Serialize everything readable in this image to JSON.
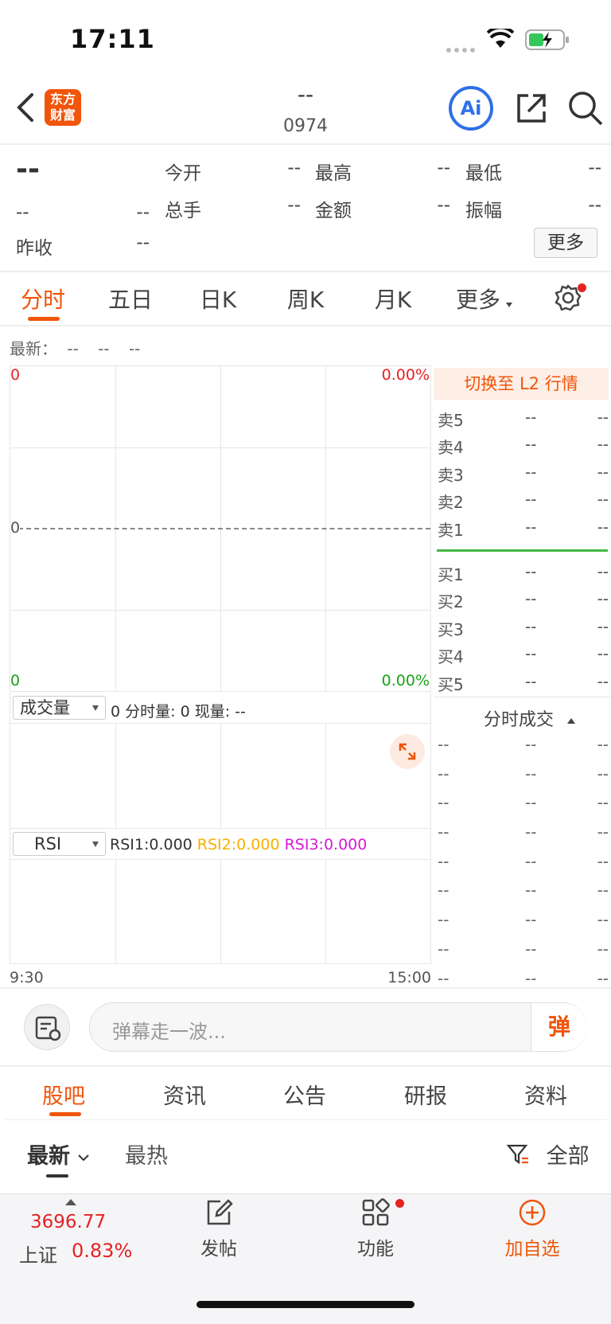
{
  "status": {
    "time": "17:11"
  },
  "header": {
    "title": "--",
    "code": "0974",
    "logo_line1": "东方",
    "logo_line2": "财富",
    "ai_label": "Ai"
  },
  "quote": {
    "price": "--",
    "change": "--",
    "change_pct": "--",
    "fields": [
      {
        "label": "今开",
        "value": "--"
      },
      {
        "label": "最高",
        "value": "--"
      },
      {
        "label": "最低",
        "value": "--"
      },
      {
        "label": "总手",
        "value": "--"
      },
      {
        "label": "金额",
        "value": "--"
      },
      {
        "label": "振幅",
        "value": "--"
      }
    ],
    "prev_close_label": "昨收",
    "prev_close_value": "--",
    "more_button": "更多"
  },
  "chart_tabs": [
    "分时",
    "五日",
    "日K",
    "周K",
    "月K",
    "更多"
  ],
  "latest_row": {
    "label": "最新：",
    "v1": "--",
    "v2": "--",
    "v3": "--"
  },
  "intraday": {
    "top_left": "0",
    "top_right": "0.00%",
    "mid_left": "0",
    "bottom_left": "0",
    "bottom_right": "0.00%",
    "time_start": "9:30",
    "time_end": "15:00"
  },
  "volume_panel": {
    "selector": "成交量",
    "stats": "0 分时量: 0 现量: --"
  },
  "rsi_panel": {
    "selector": "RSI",
    "rsi1": "RSI1:0.000",
    "rsi2": "RSI2:0.000",
    "rsi3": "RSI3:0.000"
  },
  "orderbook": {
    "l2_button": "切换至 L2 行情",
    "sells": [
      {
        "label": "卖5",
        "price": "--",
        "vol": "--"
      },
      {
        "label": "卖4",
        "price": "--",
        "vol": "--"
      },
      {
        "label": "卖3",
        "price": "--",
        "vol": "--"
      },
      {
        "label": "卖2",
        "price": "--",
        "vol": "--"
      },
      {
        "label": "卖1",
        "price": "--",
        "vol": "--"
      }
    ],
    "buys": [
      {
        "label": "买1",
        "price": "--",
        "vol": "--"
      },
      {
        "label": "买2",
        "price": "--",
        "vol": "--"
      },
      {
        "label": "买3",
        "price": "--",
        "vol": "--"
      },
      {
        "label": "买4",
        "price": "--",
        "vol": "--"
      },
      {
        "label": "买5",
        "price": "--",
        "vol": "--"
      }
    ]
  },
  "trades": {
    "title": "分时成交",
    "rows": [
      [
        "--",
        "--",
        "--"
      ],
      [
        "--",
        "--",
        "--"
      ],
      [
        "--",
        "--",
        "--"
      ],
      [
        "--",
        "--",
        "--"
      ],
      [
        "--",
        "--",
        "--"
      ],
      [
        "--",
        "--",
        "--"
      ],
      [
        "--",
        "--",
        "--"
      ],
      [
        "--",
        "--",
        "--"
      ],
      [
        "--",
        "--",
        "--"
      ]
    ]
  },
  "danmaku": {
    "placeholder": "弹幕走一波...",
    "send_label": "弹"
  },
  "section_tabs": [
    "股吧",
    "资讯",
    "公告",
    "研报",
    "资料"
  ],
  "sort_tabs": {
    "latest": "最新",
    "hot": "最热",
    "filter": "全部"
  },
  "bottom_bar": {
    "index_value": "3696.77",
    "index_name": "上证",
    "index_change": "0.83%",
    "post": "发帖",
    "func": "功能",
    "add": "加自选"
  },
  "colors": {
    "accent": "#f0550a",
    "up": "#e52222",
    "down": "#19a319",
    "blue": "#2f6fe8"
  }
}
